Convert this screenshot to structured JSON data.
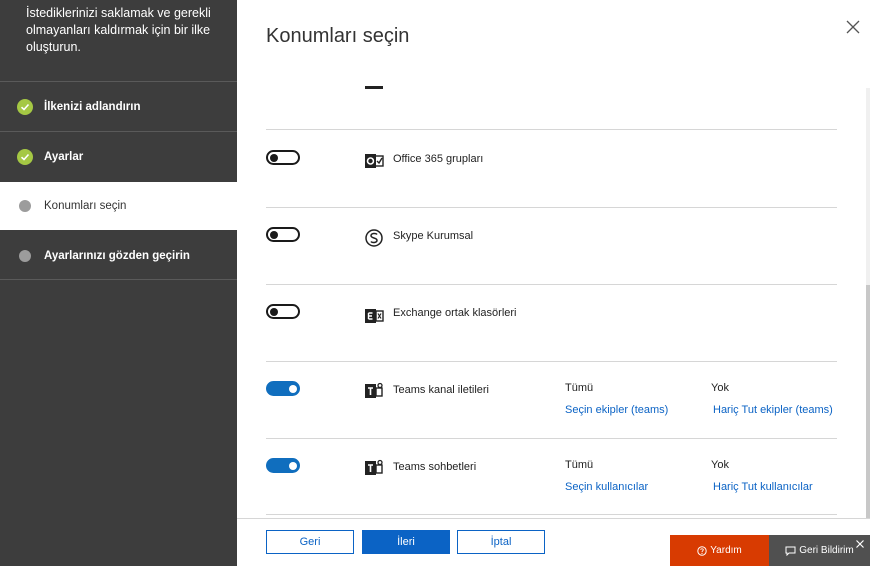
{
  "wizard": {
    "description": "İstediklerinizi saklamak ve gerekli olmayanları kaldırmak için bir ilke oluşturun.",
    "steps": [
      {
        "label": "İlkenizi adlandırın",
        "status": "done"
      },
      {
        "label": "Ayarlar",
        "status": "done"
      },
      {
        "label": "Konumları seçin",
        "status": "current"
      },
      {
        "label": "Ayarlarınızı gözden geçirin",
        "status": "pending"
      }
    ]
  },
  "panel": {
    "title": "Konumları seçin"
  },
  "locations": [
    {
      "name": "Office 365 grupları",
      "icon": "office365-groups-icon",
      "enabled": false
    },
    {
      "name": "Skype Kurumsal",
      "icon": "skype-icon",
      "enabled": false
    },
    {
      "name": "Exchange ortak klasörleri",
      "icon": "exchange-icon",
      "enabled": false
    },
    {
      "name": "Teams kanal iletileri",
      "icon": "teams-icon",
      "enabled": true,
      "included": "Tümü",
      "included_link": "Seçin ekipler (teams)",
      "excluded": "Yok",
      "excluded_link": "Hariç Tut ekipler (teams)"
    },
    {
      "name": "Teams sohbetleri",
      "icon": "teams-icon",
      "enabled": true,
      "included": "Tümü",
      "included_link": "Seçin kullanıcılar",
      "excluded": "Yok",
      "excluded_link": "Hariç Tut kullanıcılar"
    }
  ],
  "footer": {
    "back_label": "Geri",
    "next_label": "İleri",
    "cancel_label": "İptal"
  },
  "floating": {
    "help_label": "Yardım",
    "feedback_label": "Geri Bildirim"
  },
  "colors": {
    "wizard_bg": "#3d3d3d",
    "done_check": "#a5c844",
    "accent": "#0b63c5",
    "toggle_on": "#106ebe",
    "help": "#d83b01"
  }
}
